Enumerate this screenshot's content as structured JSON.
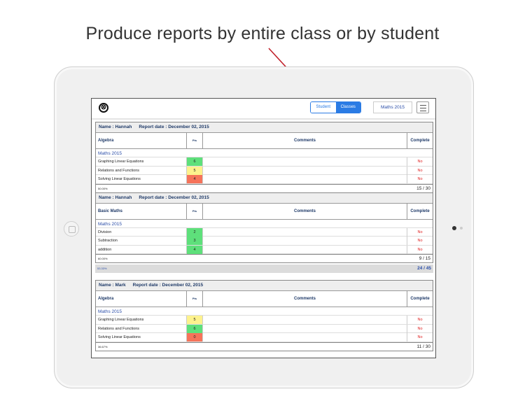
{
  "caption": "Produce reports by entire class or by student",
  "toolbar": {
    "close_symbol": "⊗",
    "tabs": [
      {
        "label": "Student"
      },
      {
        "label": "Classes"
      }
    ],
    "subject_selected": "Maths 2015",
    "menu_icon": "hamburger-icon"
  },
  "reports": [
    {
      "name": "Name : Hannah",
      "date": "Report date : December 02, 2015",
      "subject": "Algebra",
      "pts_header": "Pts",
      "comments_header": "Comments",
      "complete_header": "Complete",
      "group": "Maths 2015",
      "rows": [
        {
          "topic": "Graphing Linear Equations",
          "score": "6",
          "complete": "No"
        },
        {
          "topic": "Relations and Functions",
          "score": "5",
          "complete": "No"
        },
        {
          "topic": "Solving Linear Equations",
          "score": "4",
          "complete": "No"
        }
      ],
      "percent": "50.00%",
      "total": "15 / 30"
    },
    {
      "name": "Name : Hannah",
      "date": "Report date : December 02, 2015",
      "subject": "Basic Maths",
      "pts_header": "Pts",
      "comments_header": "Comments",
      "complete_header": "Complete",
      "group": "Maths 2015",
      "rows": [
        {
          "topic": "Division",
          "score": "2",
          "complete": "No"
        },
        {
          "topic": "Subtraction",
          "score": "3",
          "complete": "No"
        },
        {
          "topic": "addition",
          "score": "4",
          "complete": "No"
        }
      ],
      "percent": "60.00%",
      "total": "9 / 15"
    },
    {
      "name": "Name : Mark",
      "date": "Report date : December 02, 2015",
      "subject": "Algebra",
      "pts_header": "Pts",
      "comments_header": "Comments",
      "complete_header": "Complete",
      "group": "Maths 2015",
      "rows": [
        {
          "topic": "Graphing Linear Equations",
          "score": "5",
          "complete": "No"
        },
        {
          "topic": "Relations and Functions",
          "score": "6",
          "complete": "No"
        },
        {
          "topic": "Solving Linear Equations",
          "score": "0",
          "complete": "No"
        }
      ],
      "percent": "36.67%",
      "total": "11 / 30"
    }
  ],
  "overall": {
    "percent": "53.33%",
    "total": "24 / 45"
  },
  "colors": {
    "accent": "#2a7be4",
    "score_high": "#5ee07b",
    "score_mid": "#fdf28d",
    "score_low": "#f6735a",
    "incomplete": "#e02020"
  }
}
